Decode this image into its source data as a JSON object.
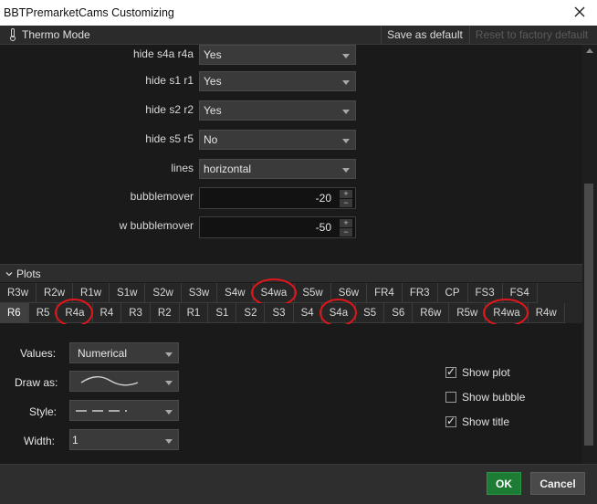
{
  "window": {
    "title": "BBTPremarketCams Customizing"
  },
  "toolbar": {
    "thermo_label": "Thermo Mode",
    "save_default": "Save as default",
    "reset_factory": "Reset to factory default"
  },
  "inputs": [
    {
      "label": "hide s4a r4a",
      "type": "dropdown",
      "value": "Yes"
    },
    {
      "label": "hide s1 r1",
      "type": "dropdown",
      "value": "Yes"
    },
    {
      "label": "hide s2 r2",
      "type": "dropdown",
      "value": "Yes"
    },
    {
      "label": "hide s5 r5",
      "type": "dropdown",
      "value": "No"
    },
    {
      "label": "lines",
      "type": "dropdown",
      "value": "horizontal"
    },
    {
      "label": "bubblemover",
      "type": "number",
      "value": "-20"
    },
    {
      "label": "w bubblemover",
      "type": "number",
      "value": "-50"
    }
  ],
  "plots": {
    "header": "Plots",
    "tabs_row1": [
      "R3w",
      "R2w",
      "R1w",
      "S1w",
      "S2w",
      "S3w",
      "S4w",
      "S4wa",
      "S5w",
      "S6w",
      "FR4",
      "FR3",
      "CP",
      "FS3",
      "FS4"
    ],
    "tabs_row2": [
      "R6",
      "R5",
      "R4a",
      "R4",
      "R3",
      "R2",
      "R1",
      "S1",
      "S2",
      "S3",
      "S4",
      "S4a",
      "S5",
      "S6",
      "R6w",
      "R5w",
      "R4wa",
      "R4w"
    ],
    "active_tab": "R6",
    "highlighted_tabs": [
      "S4wa",
      "R4a",
      "S4a",
      "R4wa"
    ]
  },
  "plot_settings": {
    "values_label": "Values:",
    "values_value": "Numerical",
    "draw_as_label": "Draw as:",
    "style_label": "Style:",
    "width_label": "Width:",
    "width_value": "1"
  },
  "options": [
    {
      "label": "Show plot",
      "checked": true
    },
    {
      "label": "Show bubble",
      "checked": false
    },
    {
      "label": "Show title",
      "checked": true
    }
  ],
  "footer": {
    "ok": "OK",
    "cancel": "Cancel"
  },
  "colors": {
    "accent_ok": "#1d7c33",
    "highlight_circle": "#e0161a",
    "background": "#1a1a1a"
  }
}
